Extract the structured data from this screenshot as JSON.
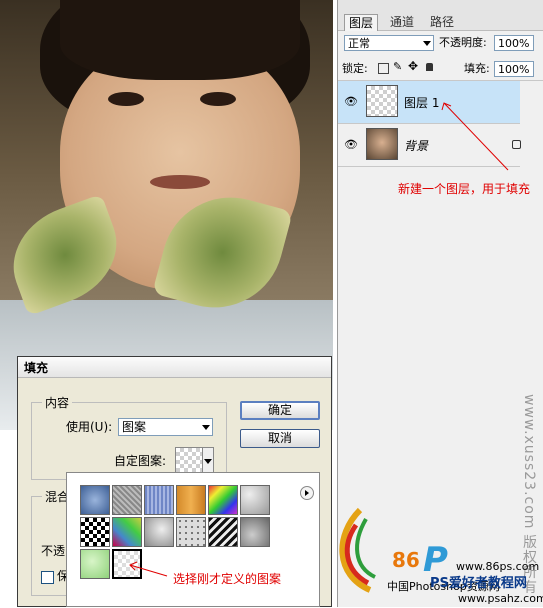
{
  "layers_panel": {
    "tabs": [
      "图层",
      "通道",
      "路径"
    ],
    "blend_mode": "正常",
    "opacity_label": "不透明度:",
    "opacity_value": "100%",
    "lock_label": "锁定:",
    "fill_label": "填充:",
    "fill_value": "100%",
    "layers": [
      {
        "name": "图层 1",
        "selected": true
      },
      {
        "name": "背景",
        "selected": false,
        "locked": true
      }
    ],
    "annotation": "新建一个图层，用于填充"
  },
  "fill_dialog": {
    "title": "填充",
    "content_group_label": "内容",
    "use_label": "使用(U):",
    "use_value": "图案",
    "custom_pattern_label": "自定图案:",
    "ok_label": "确定",
    "cancel_label": "取消",
    "blend_group_label": "混合",
    "opacity_label_partial": "不透",
    "preserve_label_partial": "保"
  },
  "pattern_picker": {
    "patterns": [
      "blue-bubbles",
      "gray-noise",
      "blue-stripes",
      "orange-wood",
      "rainbow",
      "crumpled-paper",
      "checker-black",
      "multicolor-noise",
      "gray-clouds",
      "gray-dots",
      "black-zigzag",
      "gray-stone",
      "green-leaves",
      "transparent-custom"
    ],
    "annotation": "选择刚才定义的图案"
  },
  "watermark": {
    "side_text": "www.xuss23.com 版权所有",
    "logo_number": "86",
    "logo_letter": "P",
    "site_small": "www.86ps.com",
    "site_name": "PS爱好者教程网",
    "site_prefix": "中国Photoshop资源网",
    "site_url": "www.psahz.com"
  },
  "colors": {
    "annotation_red": "#e00000",
    "selected_layer": "#c7e3f8",
    "dialog_bg": "#ece9d8"
  }
}
